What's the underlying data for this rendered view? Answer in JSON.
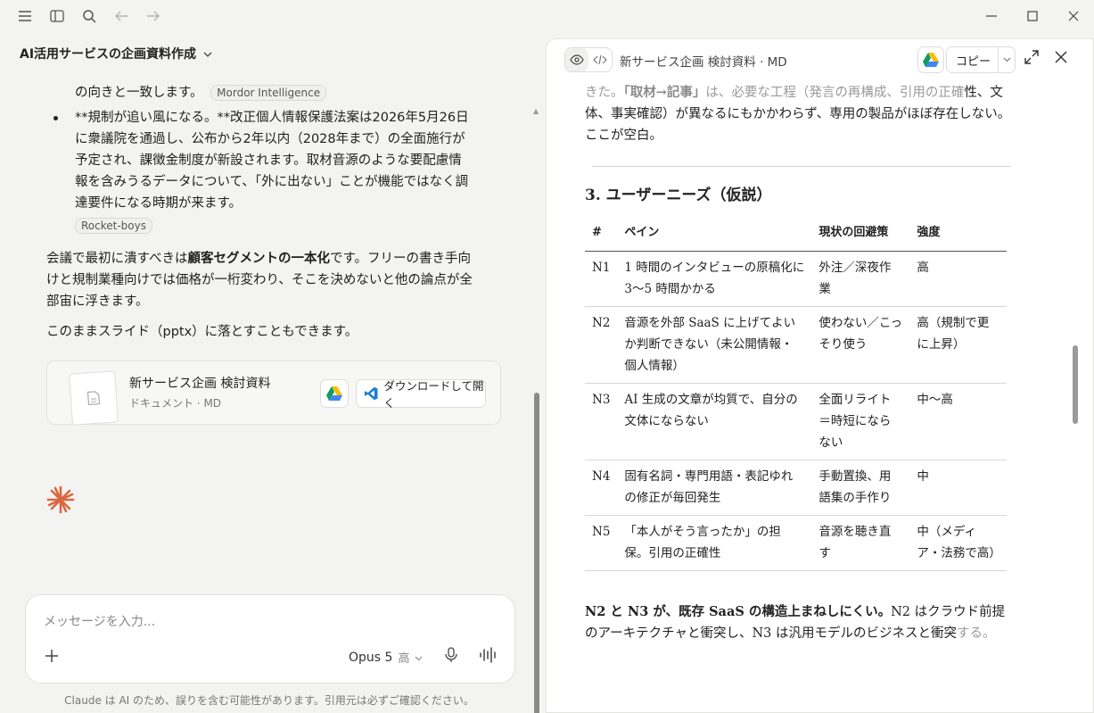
{
  "window": {
    "icons": [
      "menu-icon",
      "sidebar-toggle-icon",
      "search-icon",
      "back-arrow-icon",
      "forward-arrow-icon"
    ],
    "controls": [
      "minimize-icon",
      "maximize-icon",
      "close-icon"
    ]
  },
  "conversation": {
    "title": "AI活用サービスの企画資料作成",
    "partial_line": "の向きと一致します。",
    "partial_tag": "Mordor Intelligence",
    "bullet_text": "**規制が追い風になる。**改正個人情報保護法案は2026年5月26日に衆議院を通過し、公布から2年以内（2028年まで）の全面施行が予定され、課徴金制度が新設されます。取材音源のような要配慮情報を含みうるデータについて、「外に出ない」ことが機能ではなく調達要件になる時期が来ます。",
    "bullet_tag": "Rocket-boys",
    "para1_before": "会議で最初に潰すべきは",
    "para1_bold": "顧客セグメントの一本化",
    "para1_after": "です。フリーの書き手向けと規制業種向けでは価格が一桁変わり、そこを決めないと他の論点が全部宙に浮きます。",
    "para2": "このままスライド（pptx）に落とすこともできます。",
    "artifact": {
      "name": "新サービス企画 検討資料",
      "sub": "ドキュメント · MD",
      "download_label": "ダウンロードして開く"
    }
  },
  "composer": {
    "placeholder": "メッセージを入力...",
    "model": "Opus 5",
    "level": "高",
    "disclaimer": "Claude は AI のため、誤りを含む可能性があります。引用元は必ずご確認ください。"
  },
  "artifact_panel": {
    "title": "新サービス企画 検討資料 · MD",
    "copy_label": "コピー",
    "top_text_fade": "きた。",
    "top_text_bold": "「取材→記事」",
    "top_text_rest_fade": "は、必要な工程（発言の再構成、引用の正確",
    "top_text_cont": "性、文体、事実確認）が異なるにもかかわらず、専用の製品がほぼ存在しない。ここが空白。",
    "section_heading": "3. ユーザーニーズ（仮説）",
    "table": {
      "headers": [
        "#",
        "ペイン",
        "現状の回避策",
        "強度"
      ],
      "rows": [
        [
          "N1",
          "1 時間のインタビューの原稿化に 3〜5 時間かかる",
          "外注／深夜作業",
          "高"
        ],
        [
          "N2",
          "音源を外部 SaaS に上げてよいか判断できない（未公開情報・個人情報）",
          "使わない／こっそり使う",
          "高（規制で更に上昇）"
        ],
        [
          "N3",
          "AI 生成の文章が均質で、自分の文体にならない",
          "全面リライト＝時短にならない",
          "中〜高"
        ],
        [
          "N4",
          "固有名詞・専門用語・表記ゆれの修正が毎回発生",
          "手動置換、用語集の手作り",
          "中"
        ],
        [
          "N5",
          "「本人がそう言ったか」の担保。引用の正確性",
          "音源を聴き直す",
          "中（メディア・法務で高）"
        ]
      ]
    },
    "bottom_bold": "N2 と N3 が、既存 SaaS の構造上まねしにくい。",
    "bottom_rest": "N2 はクラウド前提のアーキテクチャと衝突し、N3 は汎用モデルのビジネスと衝突",
    "bottom_fade": "する。"
  }
}
